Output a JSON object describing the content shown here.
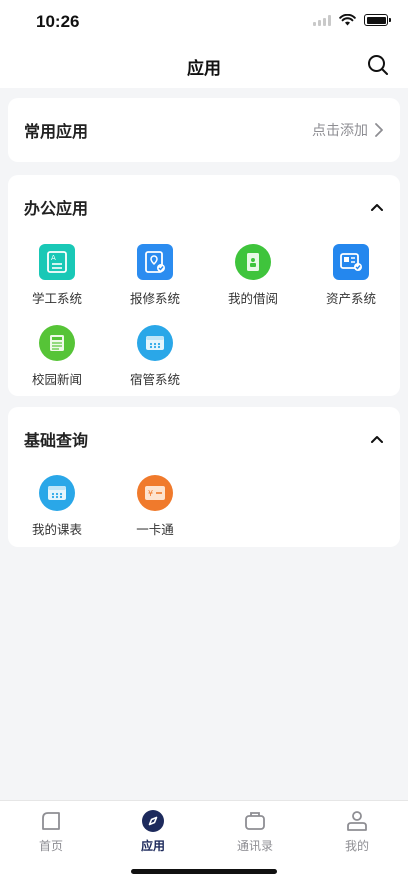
{
  "status": {
    "time": "10:26"
  },
  "header": {
    "title": "应用",
    "search_icon": "search-icon"
  },
  "frequent": {
    "title": "常用应用",
    "action_label": "点击添加"
  },
  "office": {
    "title": "办公应用",
    "apps": [
      {
        "label": "学工系统",
        "icon": "document-icon"
      },
      {
        "label": "报修系统",
        "icon": "repair-icon"
      },
      {
        "label": "我的借阅",
        "icon": "book-icon"
      },
      {
        "label": "资产系统",
        "icon": "asset-icon"
      },
      {
        "label": "校园新闻",
        "icon": "news-icon"
      },
      {
        "label": "宿管系统",
        "icon": "dorm-icon"
      }
    ]
  },
  "query": {
    "title": "基础查询",
    "apps": [
      {
        "label": "我的课表",
        "icon": "calendar-icon"
      },
      {
        "label": "一卡通",
        "icon": "card-icon"
      }
    ]
  },
  "tabs": [
    {
      "label": "首页",
      "icon": "home-icon"
    },
    {
      "label": "应用",
      "icon": "compass-icon"
    },
    {
      "label": "通讯录",
      "icon": "contacts-icon"
    },
    {
      "label": "我的",
      "icon": "user-icon"
    }
  ],
  "colors": {
    "accent": "#1d2a5c",
    "muted": "#8e8e93"
  }
}
